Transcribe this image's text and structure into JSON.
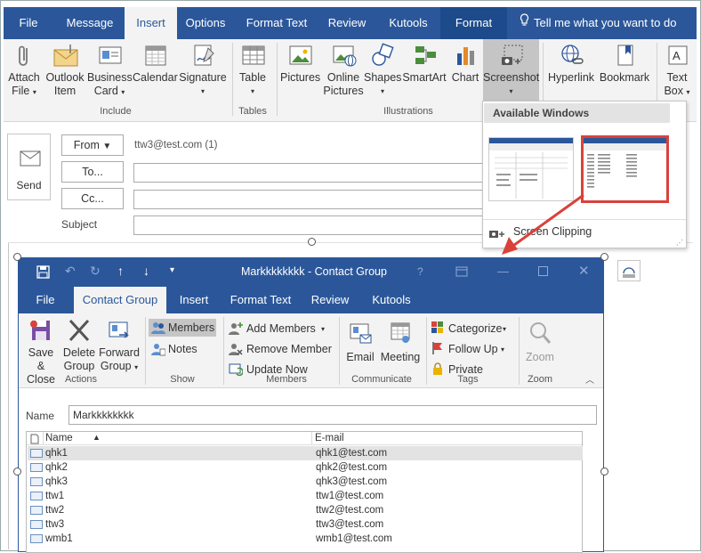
{
  "main_tabs": [
    "File",
    "Message",
    "Insert",
    "Options",
    "Format Text",
    "Review",
    "Kutools",
    "Format"
  ],
  "tell_me": "Tell me what you want to do",
  "ribbon": {
    "attach": [
      "Attach",
      "File"
    ],
    "outlook_item": [
      "Outlook",
      "Item"
    ],
    "business_card": [
      "Business",
      "Card"
    ],
    "calendar": "Calendar",
    "signature": "Signature",
    "table": "Table",
    "pictures": "Pictures",
    "online_pictures": [
      "Online",
      "Pictures"
    ],
    "shapes": "Shapes",
    "smartart": "SmartArt",
    "chart": "Chart",
    "screenshot": "Screenshot",
    "hyperlink": "Hyperlink",
    "bookmark": "Bookmark",
    "text_box": [
      "Text",
      "Box"
    ],
    "groups": {
      "include": "Include",
      "tables": "Tables",
      "illustrations": "Illustrations"
    }
  },
  "screenshot_menu": {
    "header": "Available Windows",
    "clipping": "Screen Clipping"
  },
  "compose": {
    "send": "Send",
    "from_label": "From",
    "from_value": "ttw3@test.com (1)",
    "to_label": "To...",
    "cc_label": "Cc...",
    "subject_label": "Subject"
  },
  "contact_group": {
    "title": "Markkkkkkkk  -  Contact Group",
    "help": "?",
    "tabs": [
      "File",
      "Contact Group",
      "Insert",
      "Format Text",
      "Review",
      "Kutools"
    ],
    "ribbon": {
      "save_close": [
        "Save &",
        "Close"
      ],
      "delete_group": [
        "Delete",
        "Group"
      ],
      "forward_group": [
        "Forward",
        "Group"
      ],
      "members": "Members",
      "notes": "Notes",
      "add_members": "Add Members",
      "remove_member": "Remove Member",
      "update_now": "Update Now",
      "email": "Email",
      "meeting": "Meeting",
      "categorize": "Categorize",
      "follow_up": "Follow Up",
      "private": "Private",
      "zoom": "Zoom",
      "groups": {
        "actions": "Actions",
        "show": "Show",
        "members": "Members",
        "communicate": "Communicate",
        "tags": "Tags",
        "zoom": "Zoom"
      }
    },
    "name_label": "Name",
    "name_value": "Markkkkkkkk",
    "columns": {
      "name": "Name",
      "email": "E-mail"
    },
    "rows": [
      {
        "name": "qhk1",
        "email": "qhk1@test.com"
      },
      {
        "name": "qhk2",
        "email": "qhk2@test.com"
      },
      {
        "name": "qhk3",
        "email": "qhk3@test.com"
      },
      {
        "name": "ttw1",
        "email": "ttw1@test.com"
      },
      {
        "name": "ttw2",
        "email": "ttw2@test.com"
      },
      {
        "name": "ttw3",
        "email": "ttw3@test.com"
      },
      {
        "name": "wmb1",
        "email": "wmb1@test.com"
      }
    ]
  },
  "colors": {
    "accent": "#2b579a",
    "highlight": "#d9423a",
    "ribbon_bg": "#f3f3f3"
  }
}
